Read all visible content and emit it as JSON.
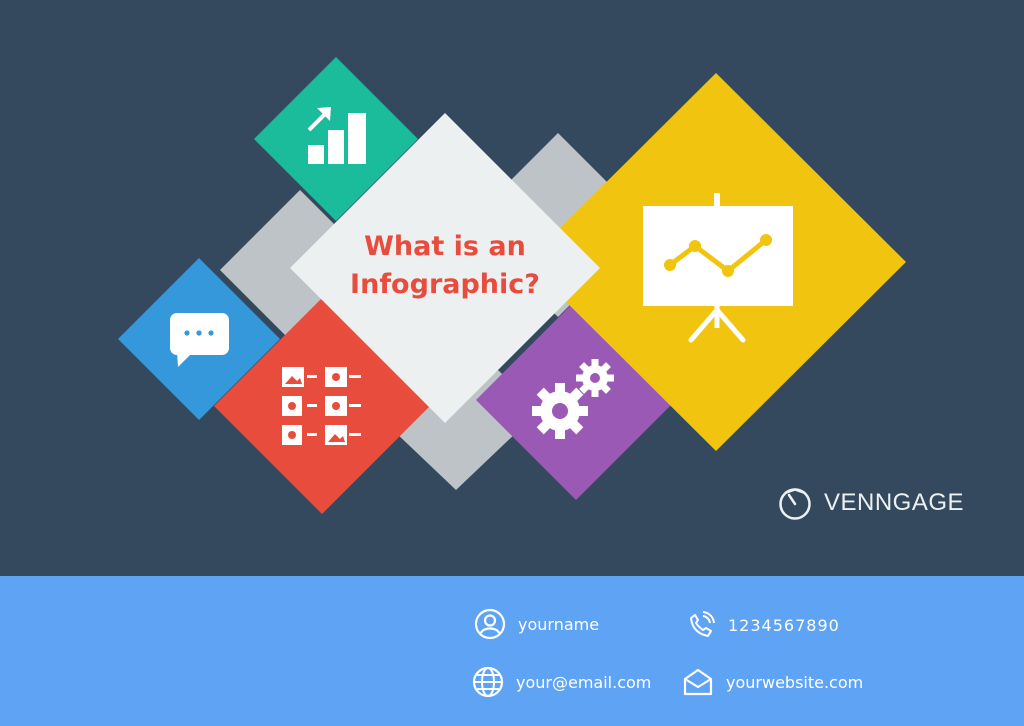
{
  "hero": {
    "title_line1": "What is an",
    "title_line2": "Infographic?",
    "colors": {
      "background": "#34495e",
      "title": "#e74c3c",
      "teal": "#1abc9c",
      "blue": "#3498db",
      "red": "#e74c3c",
      "purple": "#9b59b6",
      "yellow": "#f1c40f",
      "gray": "#bdc3c7",
      "light": "#ecf0f1"
    },
    "icons": [
      "growth-chart-icon",
      "chat-bubble-icon",
      "image-list-icon",
      "gears-icon",
      "presentation-board-icon"
    ]
  },
  "brand": {
    "name": "VENNGAGE",
    "icon": "venngage-logo-icon"
  },
  "footer": {
    "background": "#5fa3f5",
    "name": "yourname",
    "phone": "1234567890",
    "email": "your@email.com",
    "website": "yourwebsite.com",
    "icons": [
      "user-icon",
      "phone-icon",
      "globe-icon",
      "envelope-icon"
    ]
  }
}
